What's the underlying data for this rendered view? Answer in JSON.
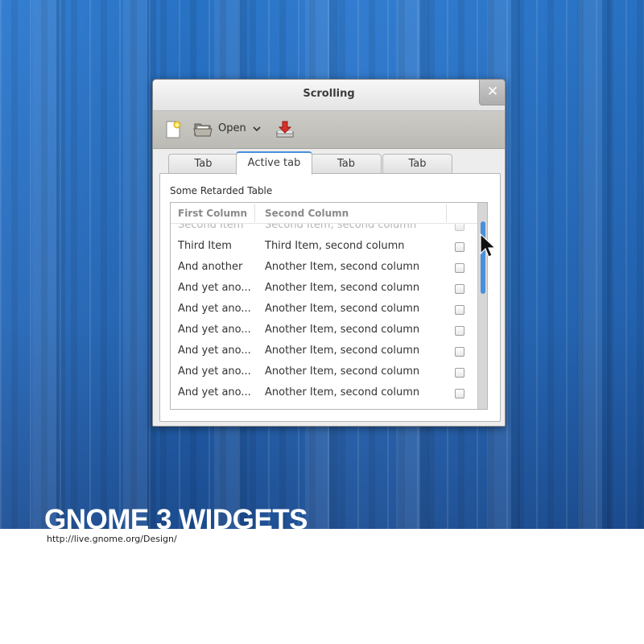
{
  "desktop": {
    "brand_title": "GNOME 3 WIDGETS",
    "brand_url": "http://live.gnome.org/Design/"
  },
  "window": {
    "title": "Scrolling",
    "close_glyph": "✕"
  },
  "toolbar": {
    "new_icon": "new-document-icon",
    "open_label": "Open",
    "open_icon": "folder-open-icon",
    "open_caret": "⌄",
    "save_icon": "download-icon"
  },
  "tabs": [
    {
      "label": "Tab",
      "active": false
    },
    {
      "label": "Active tab",
      "active": true
    },
    {
      "label": "Tab",
      "active": false
    },
    {
      "label": "Tab",
      "active": false
    }
  ],
  "table": {
    "caption": "Some Retarded Table",
    "columns": [
      "First Column",
      "Second Column",
      ""
    ],
    "rows": [
      {
        "c1": "Second Item",
        "c2": "Second Item, second column",
        "checked": false
      },
      {
        "c1": "Third Item",
        "c2": "Third Item, second column",
        "checked": false
      },
      {
        "c1": "And another",
        "c2": "Another Item, second column",
        "checked": false
      },
      {
        "c1": "And yet ano...",
        "c2": "Another Item, second column",
        "checked": false
      },
      {
        "c1": "And yet ano...",
        "c2": "Another Item, second column",
        "checked": false
      },
      {
        "c1": "And yet ano...",
        "c2": "Another Item, second column",
        "checked": false
      },
      {
        "c1": "And yet ano...",
        "c2": "Another Item, second column",
        "checked": false
      },
      {
        "c1": "And yet ano...",
        "c2": "Another Item, second column",
        "checked": false
      },
      {
        "c1": "And yet ano...",
        "c2": "Another Item, second column",
        "checked": false
      }
    ]
  },
  "colors": {
    "accent": "#4a90d9",
    "desktop_blue": "#2467b8"
  }
}
